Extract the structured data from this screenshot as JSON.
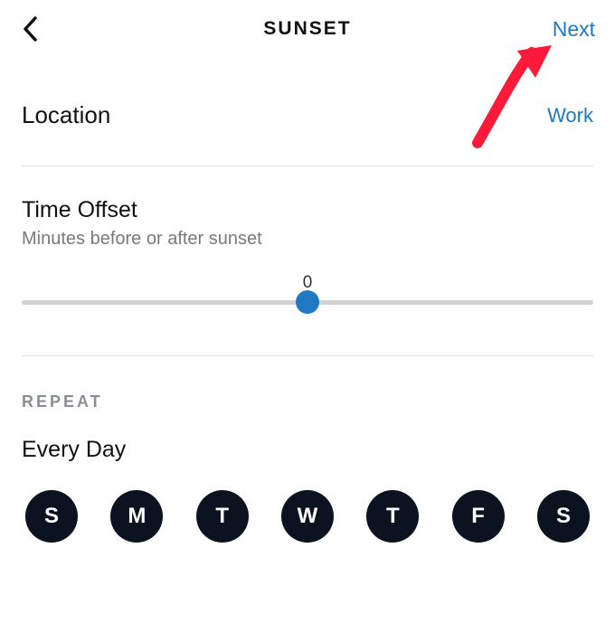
{
  "header": {
    "title": "SUNSET",
    "next_label": "Next"
  },
  "location": {
    "label": "Location",
    "value": "Work"
  },
  "offset": {
    "title": "Time Offset",
    "subtitle": "Minutes before or after sunset",
    "value": "0"
  },
  "repeat": {
    "header": "REPEAT",
    "value": "Every Day",
    "days": [
      "S",
      "M",
      "T",
      "W",
      "T",
      "F",
      "S"
    ]
  },
  "colors": {
    "accent": "#1e78c2",
    "dayFill": "#0b1320"
  }
}
